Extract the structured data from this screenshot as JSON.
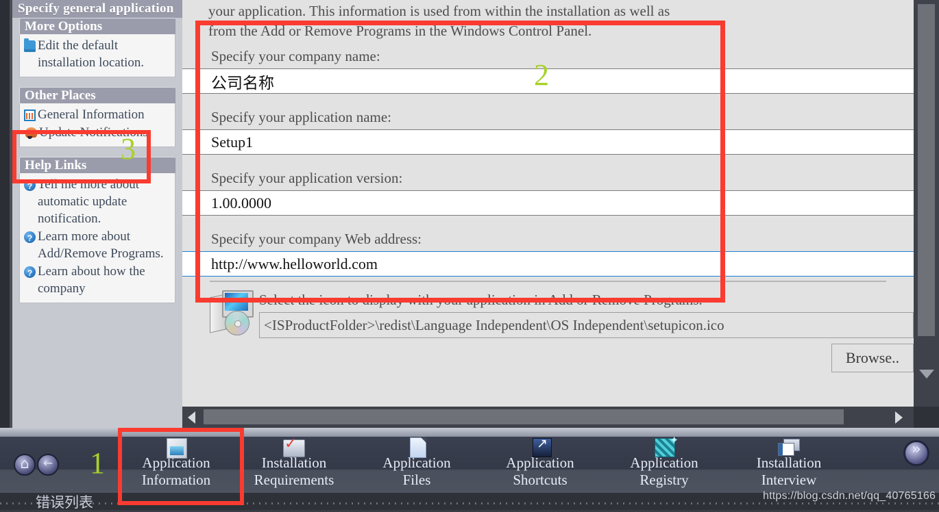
{
  "sidebar": {
    "top_header": "Specify general application",
    "panels": [
      {
        "title": "More Options",
        "items": [
          {
            "icon": "folder-icon",
            "label": "Edit the default installation location."
          }
        ]
      },
      {
        "title": "Other Places",
        "items": [
          {
            "icon": "grid-icon",
            "label": "General Information"
          },
          {
            "icon": "bell-icon",
            "label": "Update Notifications"
          }
        ]
      },
      {
        "title": "Help Links",
        "items": [
          {
            "icon": "help-icon",
            "label": "Tell me more about automatic update notification."
          },
          {
            "icon": "help-icon",
            "label": "Learn more about Add/Remove Programs."
          },
          {
            "icon": "help-icon",
            "label": "Learn about how the company"
          }
        ]
      }
    ]
  },
  "content": {
    "intro_line1": "your application. This information is used from within the installation as well as",
    "intro_line2": "from the Add or Remove Programs in the Windows Control Panel.",
    "fields": [
      {
        "label": "Specify your company name:",
        "value": "公司名称",
        "focused": false,
        "cjk": true
      },
      {
        "label": "Specify your application name:",
        "value": "Setup1",
        "focused": false,
        "cjk": false
      },
      {
        "label": "Specify your application version:",
        "value": "1.00.0000",
        "focused": false,
        "cjk": false
      },
      {
        "label": "Specify your company Web address:",
        "value": "http://www.helloworld.com",
        "focused": true,
        "cjk": false
      }
    ],
    "icon_section": {
      "icon": "setup-cd-icon",
      "caption": "Select the icon to display with your application in Add or Remove Programs.",
      "path_value": "<ISProductFolder>\\redist\\Language Independent\\OS Independent\\setupicon.ico",
      "browse_label": "Browse.."
    }
  },
  "taskbar": {
    "home_icon": "home-icon",
    "back_icon": "back-arrow-icon",
    "next_icon": "next-arrow-icon",
    "tabs": [
      {
        "icon": "application-box-icon",
        "line1": "Application",
        "line2": "Information",
        "selected": true
      },
      {
        "icon": "requirements-monitor-icon",
        "line1": "Installation",
        "line2": "Requirements",
        "selected": false
      },
      {
        "icon": "file-document-icon",
        "line1": "Application",
        "line2": "Files",
        "selected": false
      },
      {
        "icon": "shortcut-arrow-icon",
        "line1": "Application",
        "line2": "Shortcuts",
        "selected": false
      },
      {
        "icon": "registry-blocks-icon",
        "line1": "Application",
        "line2": "Registry",
        "selected": false
      },
      {
        "icon": "interview-window-icon",
        "line1": "Installation",
        "line2": "Interview",
        "selected": false
      }
    ]
  },
  "statusbar": {
    "error_list_label": "错误列表",
    "watermark": "https://blog.csdn.net/qq_40765166"
  },
  "annotations": {
    "marker1": "1",
    "marker2": "2",
    "marker3": "3",
    "box_color": "#fa3b30",
    "number_color": "#a8d12a"
  }
}
